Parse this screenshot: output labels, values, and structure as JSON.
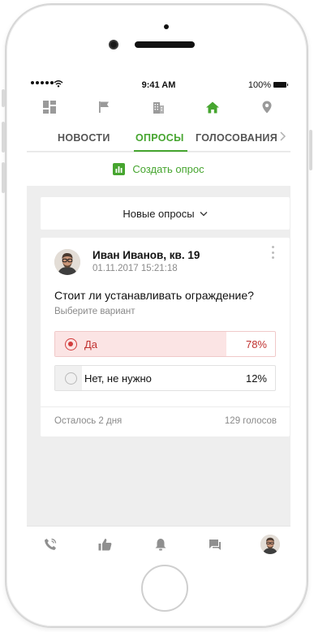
{
  "status_bar": {
    "time": "9:41 AM",
    "battery": "100%"
  },
  "top_icons": [
    "dashboard-icon",
    "flag-icon",
    "building-icon",
    "home-icon",
    "location-pin-icon"
  ],
  "tabs": [
    {
      "label": "НОВОСТИ",
      "active": false
    },
    {
      "label": "ОПРОСЫ",
      "active": true
    },
    {
      "label": "ГОЛОСОВАНИЯ",
      "active": false
    }
  ],
  "create_poll": {
    "label": "Создать опрос"
  },
  "filter": {
    "label": "Новые опросы"
  },
  "poll": {
    "author": "Иван Иванов, кв. 19",
    "date": "01.11.2017 15:21:18",
    "question": "Стоит ли устанавливать ограждение?",
    "hint": "Выберите вариант",
    "options": [
      {
        "label": "Да",
        "percent": "78%",
        "share": 0.78,
        "selected": true
      },
      {
        "label": "Нет, не нужно",
        "percent": "12%",
        "share": 0.12,
        "selected": false
      }
    ],
    "remaining": "Осталось 2 дня",
    "votes": "129 голосов"
  },
  "bottom_icons": [
    "call-icon",
    "thumbs-up-icon",
    "bell-icon",
    "chat-icon",
    "profile-avatar"
  ],
  "colors": {
    "accent_green": "#46a52f",
    "selected_red": "#c0302e",
    "selected_fill": "#fbe4e4",
    "background": "#eeeeee"
  }
}
